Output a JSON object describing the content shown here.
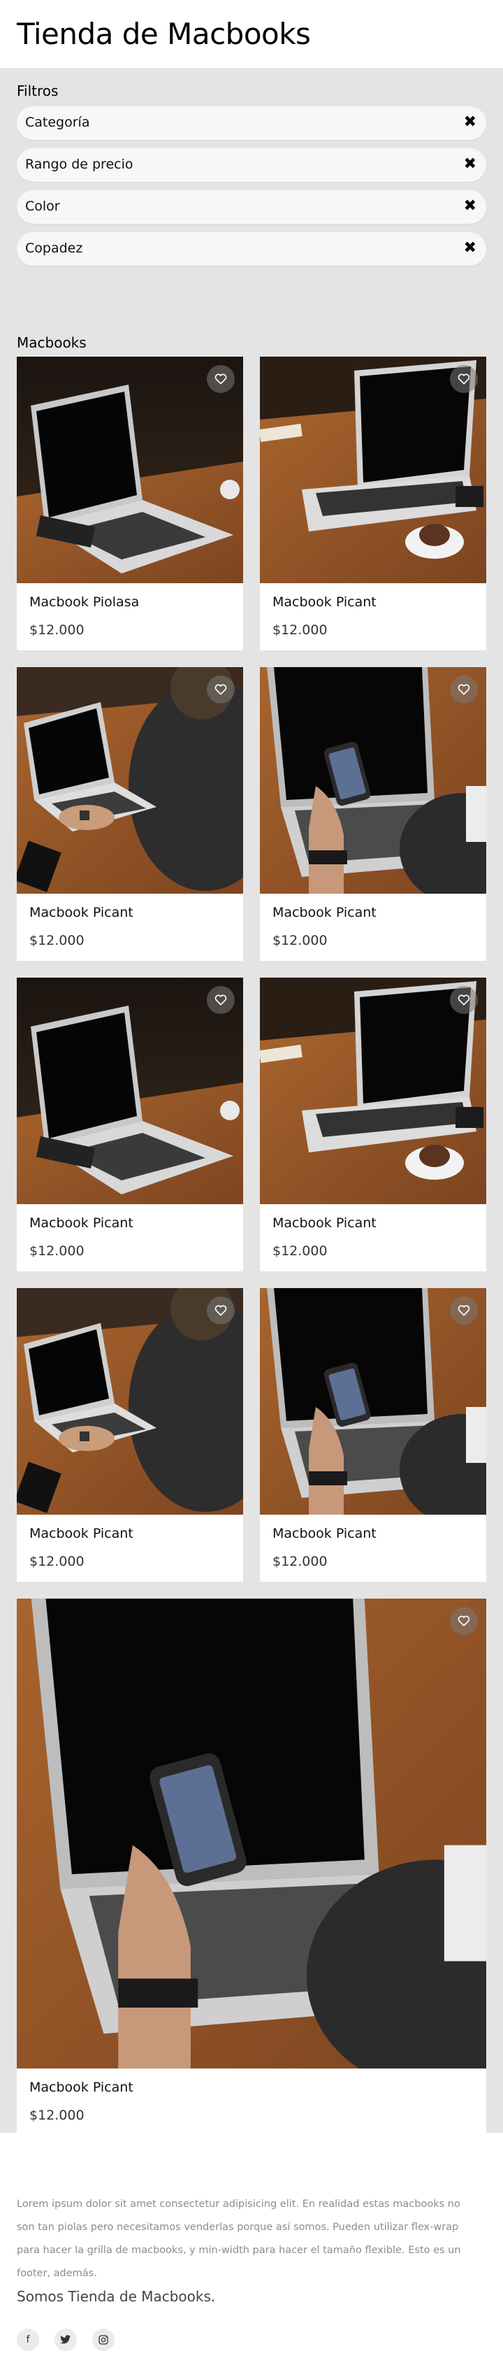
{
  "header": {
    "title": "Tienda de Macbooks"
  },
  "filters": {
    "title": "Filtros",
    "items": [
      {
        "label": "Categoría",
        "clear_icon": "close-icon"
      },
      {
        "label": "Rango de precio",
        "clear_icon": "close-icon"
      },
      {
        "label": "Color",
        "clear_icon": "close-icon"
      },
      {
        "label": "Copadez",
        "clear_icon": "close-icon"
      }
    ]
  },
  "products": {
    "title": "Macbooks",
    "items": [
      {
        "name": "Macbook Piolasa",
        "price": "$12.000",
        "image": "laptop-dark-desk"
      },
      {
        "name": "Macbook Picant",
        "price": "$12.000",
        "image": "laptop-coffee"
      },
      {
        "name": "Macbook Picant",
        "price": "$12.000",
        "image": "typing-hands"
      },
      {
        "name": "Macbook Picant",
        "price": "$12.000",
        "image": "phone-hand"
      },
      {
        "name": "Macbook Picant",
        "price": "$12.000",
        "image": "laptop-dark-desk"
      },
      {
        "name": "Macbook Picant",
        "price": "$12.000",
        "image": "laptop-coffee"
      },
      {
        "name": "Macbook Picant",
        "price": "$12.000",
        "image": "typing-hands"
      },
      {
        "name": "Macbook Picant",
        "price": "$12.000",
        "image": "phone-hand"
      },
      {
        "name": "Macbook Picant",
        "price": "$12.000",
        "image": "phone-hand"
      }
    ]
  },
  "footer": {
    "text": "Lorem ipsum dolor sit amet consectetur adipisicing elit. En realidad estas macbooks no son tan piolas pero necesitamos venderlas porque así somos. Pueden utilizar flex-wrap para hacer la grilla de macbooks, y min-width para hacer el tamaño flexible. Esto es un footer, además.",
    "name": "Somos Tienda de Macbooks.",
    "social": [
      "facebook-icon",
      "twitter-icon",
      "instagram-icon"
    ]
  },
  "colors": {
    "page_bg": "#e4e4e4",
    "card_bg": "#ffffff",
    "wood": "#9a5a2a"
  }
}
